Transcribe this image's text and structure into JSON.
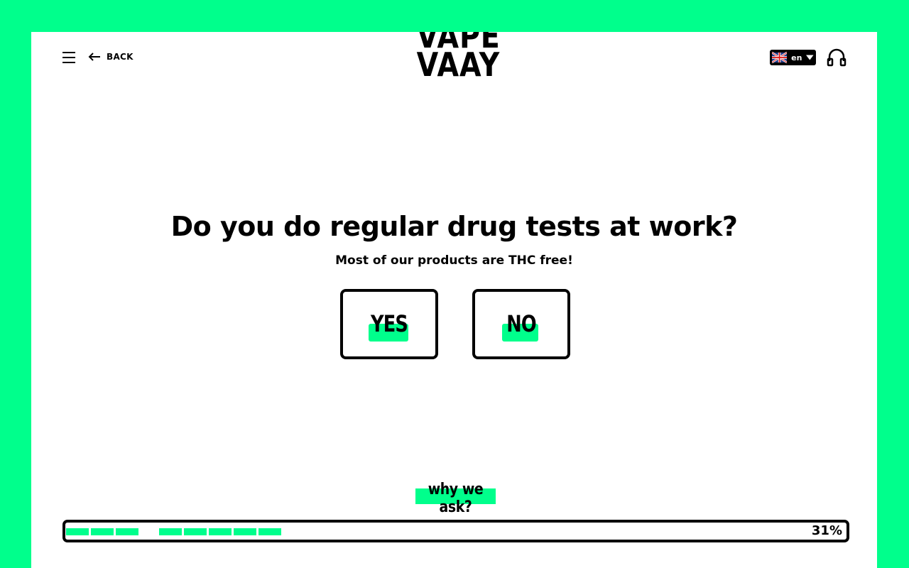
{
  "header": {
    "back_label": "BACK",
    "logo_line1": "VAPE",
    "logo_line2": "VAAY",
    "language": "en"
  },
  "quiz": {
    "question": "Do you do regular drug tests at work?",
    "subtitle": "Most of our products are THC free!",
    "answers": [
      "YES",
      "NO"
    ],
    "why_label": "why we ask?"
  },
  "progress": {
    "percent_label": "31%",
    "percent": 31
  },
  "colors": {
    "accent": "#00ff8c",
    "ink": "#000000",
    "panel": "#ffffff"
  },
  "icons": {
    "menu": "hamburger-icon",
    "back": "arrow-left-icon",
    "flag": "uk-flag-icon",
    "caret": "chevron-down-icon",
    "support": "headphones-icon"
  }
}
